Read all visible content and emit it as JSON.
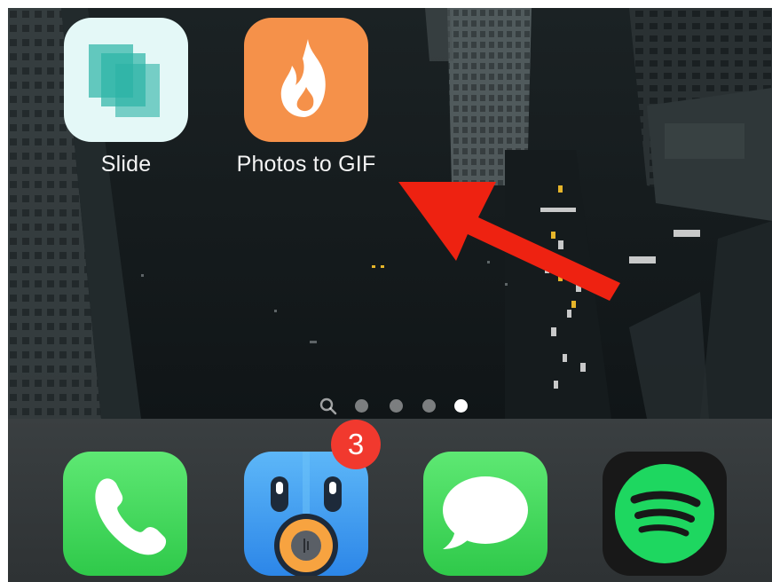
{
  "home_screen": {
    "apps": [
      {
        "label": "Slide",
        "icon": "slide-app-icon"
      },
      {
        "label": "Photos to GIF",
        "icon": "flame-icon",
        "color": "#f5914a"
      }
    ],
    "page_indicator": {
      "pages": 4,
      "current_page": 4,
      "has_spotlight": true
    }
  },
  "dock": {
    "apps": [
      {
        "name": "Phone",
        "icon": "phone-icon",
        "color": "#4cd964"
      },
      {
        "name": "Tweetbot",
        "icon": "tweetbot-icon",
        "badge": "3",
        "color": "#3b9ff0"
      },
      {
        "name": "Messages",
        "icon": "speech-bubble-icon",
        "color": "#4cd964"
      },
      {
        "name": "Spotify",
        "icon": "spotify-icon",
        "color": "#1ed760"
      }
    ]
  },
  "annotation": {
    "type": "arrow",
    "color": "#ee2211",
    "points_to": "Photos to GIF"
  },
  "colors": {
    "badge": "#f1392e",
    "wallpaper": "#141a1c",
    "dock": "#33383a"
  }
}
